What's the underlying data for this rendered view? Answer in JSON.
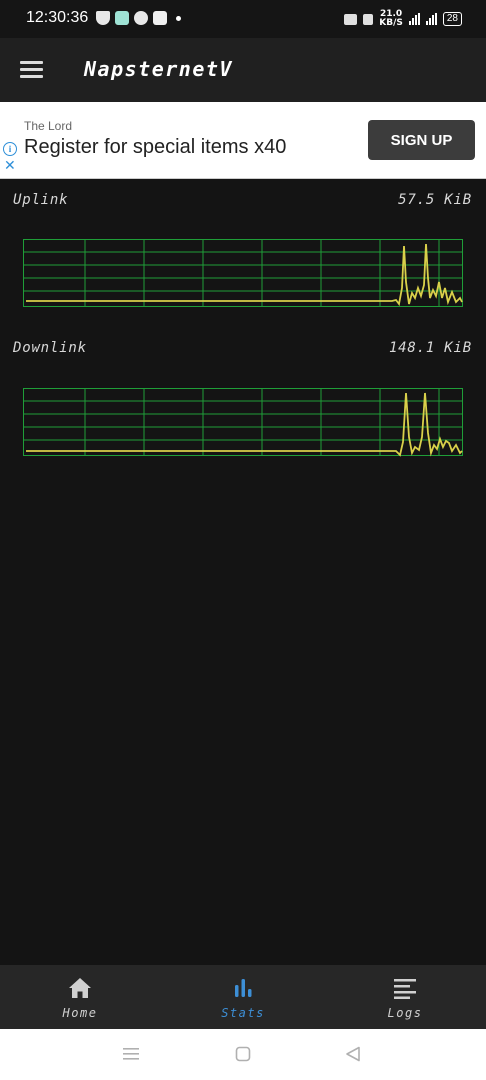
{
  "status_bar": {
    "time": "12:30:36",
    "net_speed_value": "21.0",
    "net_speed_unit": "KB/S",
    "battery": "28"
  },
  "app": {
    "title": "NapsternetV"
  },
  "ad": {
    "advertiser": "The Lord",
    "headline": "Register for special items x40",
    "cta": "SIGN UP"
  },
  "stats": {
    "uplink": {
      "label": "Uplink",
      "value": "57.5 KiB"
    },
    "downlink": {
      "label": "Downlink",
      "value": "148.1 KiB"
    }
  },
  "bottom_nav": {
    "home": "Home",
    "stats": "Stats",
    "logs": "Logs",
    "active": "stats"
  },
  "colors": {
    "background": "#141414",
    "grid_green": "#1f9e38",
    "trace_yellow": "#d9d04a",
    "active_tab": "#3d8fd6"
  }
}
